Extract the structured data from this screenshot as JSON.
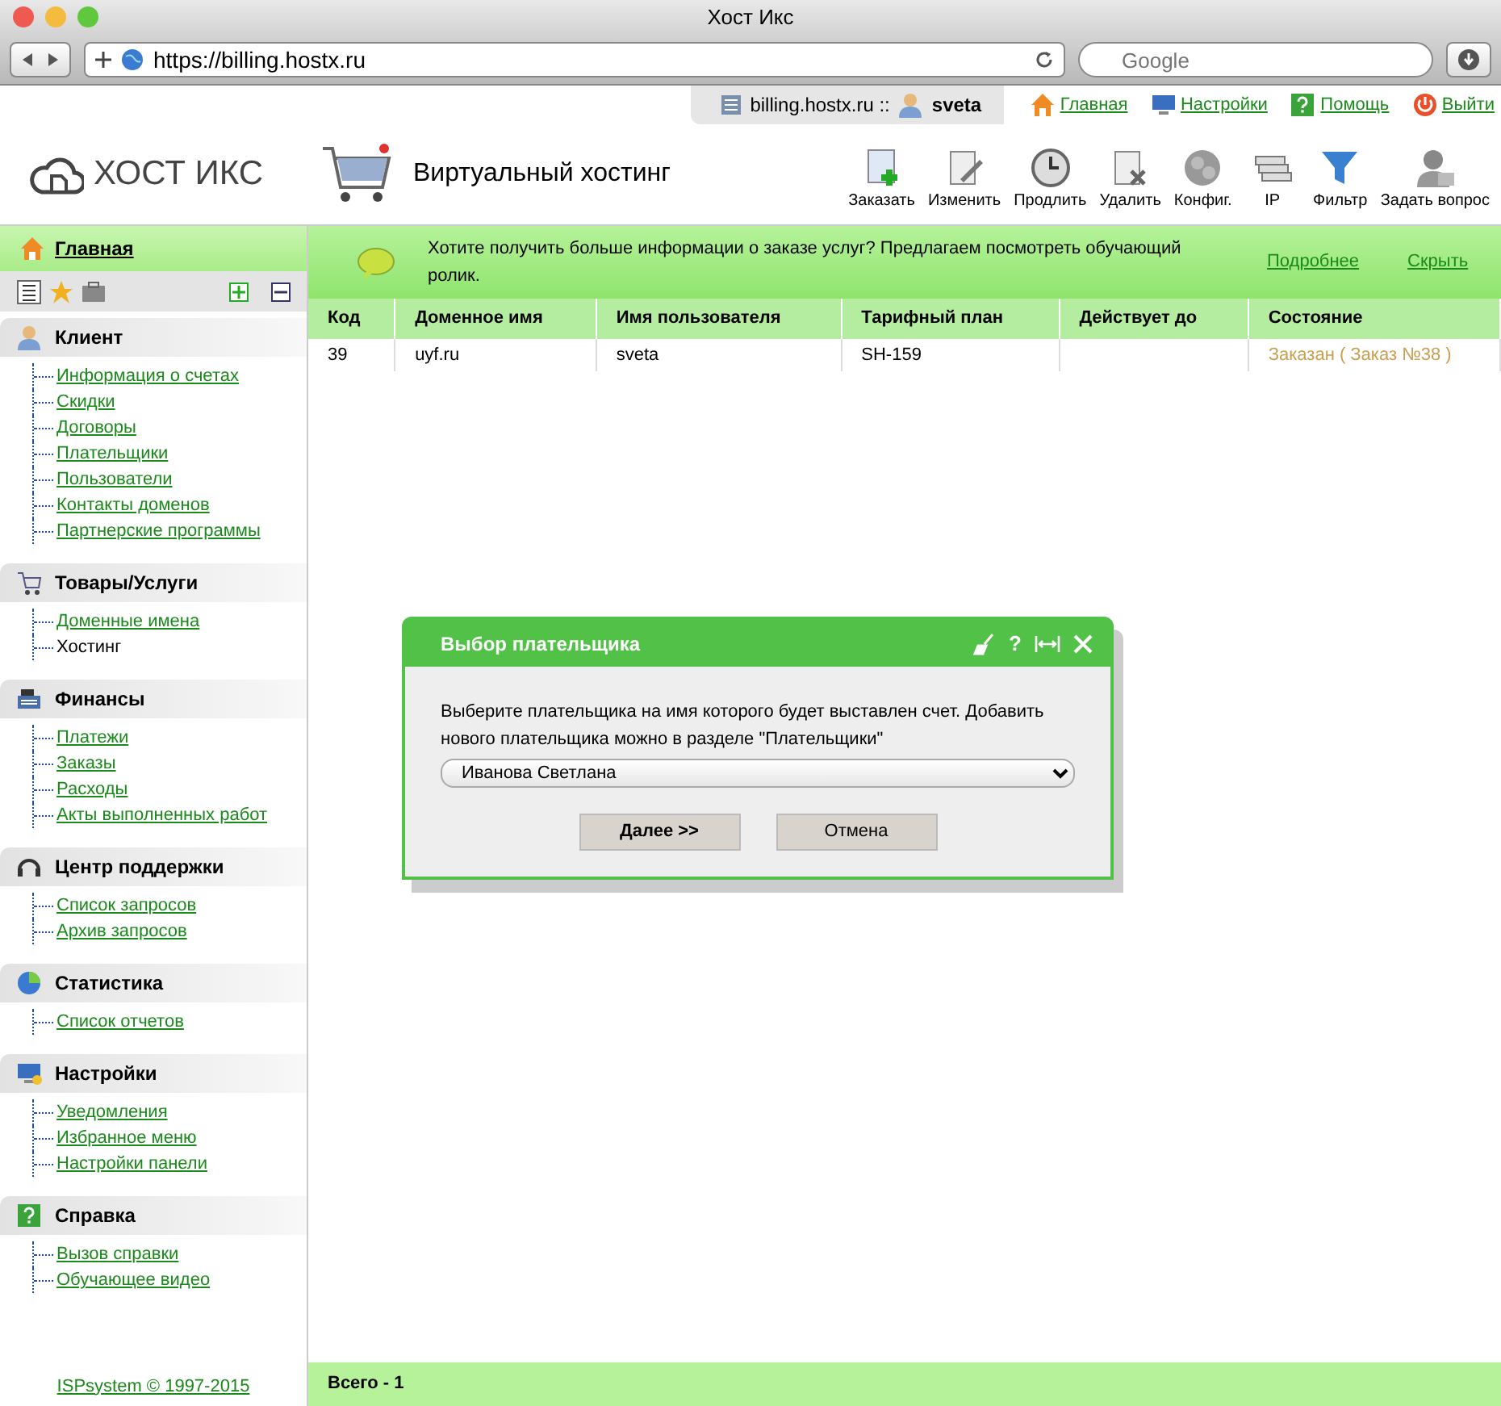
{
  "browser": {
    "title": "Хост Икс",
    "url": "https://billing.hostx.ru",
    "search_placeholder": "Google"
  },
  "topbar": {
    "host": "billing.hostx.ru ::",
    "user": "sveta",
    "links": [
      "Главная",
      "Настройки",
      "Помощь",
      "Выйти"
    ]
  },
  "header": {
    "logo": "ХОСТ ИКС",
    "section": "Виртуальный хостинг",
    "tools": [
      "Заказать",
      "Изменить",
      "Продлить",
      "Удалить",
      "Конфиг.",
      "IP",
      "Фильтр",
      "Задать вопрос"
    ]
  },
  "sidebar": {
    "home": {
      "label": "Главная",
      "selected": true
    },
    "groups": [
      {
        "title": "Клиент",
        "items": [
          {
            "label": "Информация о счетах",
            "selected": false
          },
          {
            "label": "Скидки",
            "selected": false
          },
          {
            "label": "Договоры",
            "selected": false
          },
          {
            "label": "Плательщики",
            "selected": false
          },
          {
            "label": "Пользователи",
            "selected": false
          },
          {
            "label": "Контакты доменов",
            "selected": false
          },
          {
            "label": "Партнерские программы",
            "selected": false
          }
        ]
      },
      {
        "title": "Товары/Услуги",
        "items": [
          {
            "label": "Доменные имена",
            "selected": false
          },
          {
            "label": "Хостинг",
            "selected": true
          }
        ]
      },
      {
        "title": "Финансы",
        "items": [
          {
            "label": "Платежи",
            "selected": false
          },
          {
            "label": "Заказы",
            "selected": false
          },
          {
            "label": "Расходы",
            "selected": false
          },
          {
            "label": "Акты выполненных работ",
            "selected": false
          }
        ]
      },
      {
        "title": "Центр поддержки",
        "items": [
          {
            "label": "Список запросов",
            "selected": false
          },
          {
            "label": "Архив запросов",
            "selected": false
          }
        ]
      },
      {
        "title": "Статистика",
        "items": [
          {
            "label": "Список отчетов",
            "selected": false
          }
        ]
      },
      {
        "title": "Настройки",
        "items": [
          {
            "label": "Уведомления",
            "selected": false
          },
          {
            "label": "Избранное меню",
            "selected": false
          },
          {
            "label": "Настройки панели",
            "selected": false
          }
        ]
      },
      {
        "title": "Справка",
        "items": [
          {
            "label": "Вызов справки",
            "selected": false
          },
          {
            "label": "Обучающее видео",
            "selected": false
          }
        ]
      }
    ],
    "footer": "ISPsystem © 1997-2015"
  },
  "banner": {
    "text": "Хотите получить больше информации о заказе услуг? Предлагаем посмотреть обучающий ролик.",
    "links": [
      "Подробнее",
      "Скрыть"
    ]
  },
  "table": {
    "columns": [
      "Код",
      "Доменное имя",
      "Имя пользователя",
      "Тарифный план",
      "Действует до",
      "Состояние"
    ],
    "rows": [
      {
        "cells": [
          "39",
          "uyf.ru",
          "sveta",
          "SH-159",
          "",
          "Заказан ( Заказ №38 )"
        ]
      }
    ],
    "total": "Всего - 1"
  },
  "dialog": {
    "title": "Выбор плательщика",
    "controls": [
      "?"
    ],
    "message": "Выберите плательщика на имя которого будет выставлен счет. Добавить нового плательщика можно в разделе \"Плательщики\"",
    "select_value": "Иванова Светлана",
    "buttons": [
      "Далее >>",
      "Отмена"
    ]
  }
}
